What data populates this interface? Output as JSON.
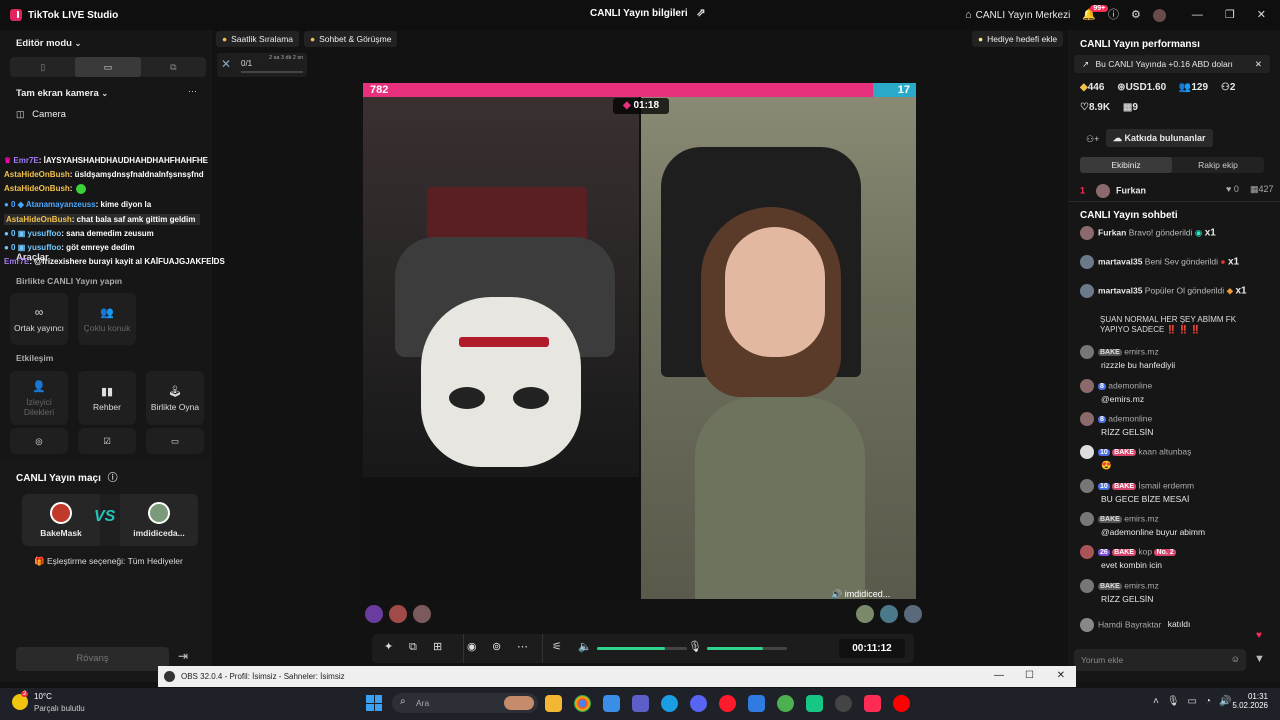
{
  "titlebar": {
    "app_name": "TikTok LIVE Studio",
    "center_title": "CANLI Yayın bilgileri",
    "center_link": "CANLI Yayın Merkezi",
    "notif_badge": "99+"
  },
  "left": {
    "editor_mode": "Editör modu",
    "camera_title": "Tam ekran kamera",
    "camera_item": "Camera",
    "chat": [
      {
        "user": "Emr7E",
        "text": ": İAYSYAHSHAHDHAUDHAHDHAHFHAHFHE",
        "color": "#a27bf4"
      },
      {
        "user": "AstaHideOnBush",
        "text": ": üsldşamşdnsşfnaldnalnfşsnsşfnd",
        "color": "#f3c14b"
      },
      {
        "user": "AstaHideOnBush",
        "text": ":",
        "color": "#f3c14b"
      },
      {
        "user": "Atanamayanzeuss",
        "text": ": kime diyon la",
        "color": "#4ea7ff"
      },
      {
        "user": "AstaHideOnBush",
        "text": ": chat bala saf amk gittim geldim",
        "color": "#f3c14b"
      },
      {
        "user": "yusuffoo",
        "text": ": sana demedim zeusum",
        "color": "#6fc8ff"
      },
      {
        "user": "yusuffoo",
        "text": ": göt emreye dedim",
        "color": "#6fc8ff"
      },
      {
        "user": "Emr7E",
        "text": ": @frizexishere burayi kayit al KAİFUAJGJAKFEİDS",
        "color": "#a27bf4"
      }
    ],
    "tools_label": "Araçlar",
    "collab_label": "Birlikte CANLI Yayın yapın",
    "cohost": "Ortak yayıncı",
    "multiguest": "Çoklu konuk",
    "interaction_label": "Etkileşim",
    "viewer_requests": "İzleyici Dilekleri",
    "guide": "Rehber",
    "play_together": "Birlikte Oyna",
    "battle_title": "CANLI Yayın maçı",
    "player1": "BakeMask",
    "player2": "imdidiceda...",
    "vs": "VS",
    "match_option": "Eşleştirme seçeneği: Tüm Hediyeler",
    "rematch": "Rövanş"
  },
  "center": {
    "chip_hourly": "Saatlik Sıralama",
    "chip_chat": "Sohbet & Görüşme",
    "chip_gift_goal": "Hediye hedefi ekle",
    "goal_progress": "0/1",
    "goal_timer": "2 sa 3 dk 2 sn",
    "score_left": "782",
    "score_right": "17",
    "battle_timer": "01:18",
    "guest_name": "imdidiced...",
    "stream_time": "00:11:12",
    "volume_level": 0.75,
    "mic_level": 0.7
  },
  "right": {
    "perf_title": "CANLI Yayın performansı",
    "earnings_note": "Bu CANLI Yayında +0.16 ABD doları",
    "stats": [
      {
        "icon": "diamond-icon",
        "value": "446"
      },
      {
        "icon": "coin-icon",
        "value": "USD1.60"
      },
      {
        "icon": "viewers-icon",
        "value": "129"
      },
      {
        "icon": "people-icon",
        "value": "2"
      },
      {
        "icon": "heart-icon",
        "value": "8.9K"
      },
      {
        "icon": "gift-icon",
        "value": "9"
      }
    ],
    "contributors": "Katkıda bulunanlar",
    "tab_ours": "Ekibiniz",
    "tab_rival": "Rakip ekip",
    "top_rank": "1",
    "top_name": "Furkan",
    "top_likes": "0",
    "top_gifts": "427",
    "chat_title": "CANLI Yayın sohbeti",
    "gifts": [
      {
        "user": "Furkan",
        "text": "Bravo! gönderildi",
        "count": "x1"
      },
      {
        "user": "martaval35",
        "text": "Beni Sev gönderildi",
        "count": "x1"
      },
      {
        "user": "martaval35",
        "text": "Popüler Ol gönderildi",
        "count": "x1"
      }
    ],
    "pinned": "ŞUAN NORMAL HER ŞEY ABİMM FK YAPIYO SADECE ‼️ ‼️ ‼️",
    "messages": [
      {
        "badges": [
          "BAKE"
        ],
        "user": "emirs.mz",
        "text": "rizzzle bu hanfediyii"
      },
      {
        "badges": [
          "8"
        ],
        "user": "ademonline",
        "text": "@emirs.mz"
      },
      {
        "badges": [
          "8"
        ],
        "user": "ademonline",
        "text": "RİZZ GELSİN"
      },
      {
        "badges": [
          "10",
          "BAKE"
        ],
        "user": "kaan altunbaş",
        "text": ""
      },
      {
        "badges": [
          "10",
          "BAKE"
        ],
        "user": "İsmail erdemm",
        "text": "BU GECE BİZE MESAİ"
      },
      {
        "badges": [
          "BAKE"
        ],
        "user": "emirs.mz",
        "text": "@ademonline buyur abimm"
      },
      {
        "badges": [
          "26",
          "BAKE",
          "No. 2"
        ],
        "user": "kop",
        "text": "evet kombin icin"
      },
      {
        "badges": [
          "BAKE"
        ],
        "user": "emirs.mz",
        "text": "RİZZ GELSİN"
      }
    ],
    "joined_user": "Hamdi Bayraktar",
    "joined_text": "katıldı",
    "comment_placeholder": "Yorum ekle"
  },
  "obs": {
    "title": "OBS 32.0.4 - Profil: İsimsiz - Sahneler: İsimsiz"
  },
  "taskbar": {
    "weather_temp": "10°C",
    "weather_desc": "Parçalı bulutlu",
    "weather_badge": "2",
    "search_placeholder": "Ara",
    "time": "01:31",
    "date": "5.02.2026"
  },
  "colors": {
    "accent_pink": "#e8307c",
    "accent_teal": "#2aa9c9",
    "slider_green": "#2fd58e"
  }
}
